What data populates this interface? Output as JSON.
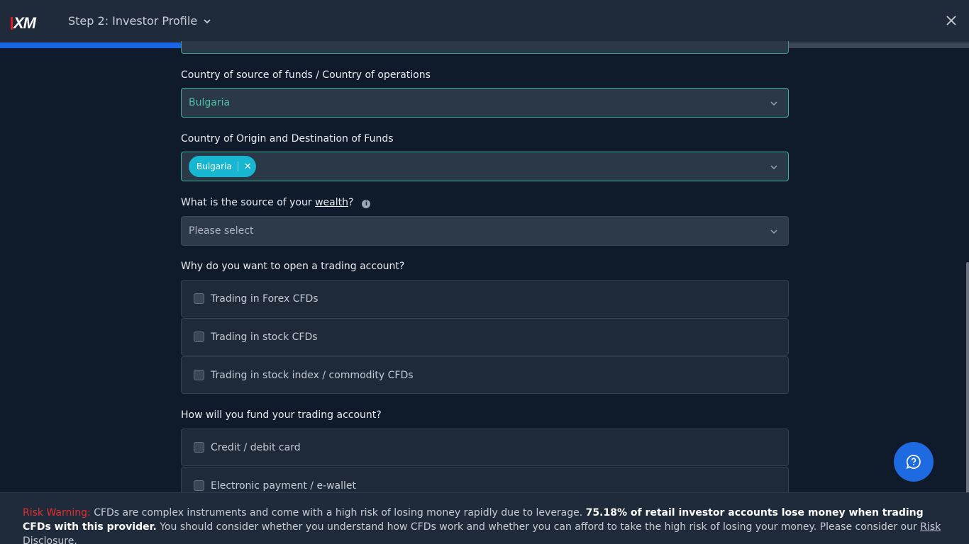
{
  "header": {
    "logo": "XM",
    "step_title": "Step 2: Investor Profile",
    "progress": 0.495
  },
  "form": {
    "source_funds": {
      "label": "Country of source of funds / Country of operations",
      "value": "Bulgaria"
    },
    "origin_destination": {
      "label": "Country of Origin and Destination of Funds",
      "tags": [
        "Bulgaria"
      ]
    },
    "wealth": {
      "label_prefix": "What is the source of your ",
      "label_link": "wealth",
      "label_suffix": "?",
      "placeholder": "Please select"
    },
    "reason": {
      "label": "Why do you want to open a trading account?",
      "options": [
        "Trading in Forex CFDs",
        "Trading in stock CFDs",
        "Trading in stock index / commodity CFDs"
      ]
    },
    "funding": {
      "label": "How will you fund your trading account?",
      "options": [
        "Credit / debit card",
        "Electronic payment / e-wallet"
      ]
    }
  },
  "risk": {
    "title": "Risk Warning:",
    "text1": " CFDs are complex instruments and come with a high risk of losing money rapidly due to leverage. ",
    "bold": "75.18% of retail investor accounts lose money when trading CFDs with this provider.",
    "text2": " You should consider whether you understand how CFDs work and whether you can afford to take the high risk of losing your money. Please consider our ",
    "link": "Risk Disclosure",
    "end": "."
  },
  "colors": {
    "accent": "#1a64e6",
    "valid": "#3fb09a",
    "tag": "#17b7d2",
    "warning": "#e03030"
  },
  "icons": [
    "chevron-down-icon",
    "close-icon",
    "info-icon",
    "help-chat-icon"
  ]
}
